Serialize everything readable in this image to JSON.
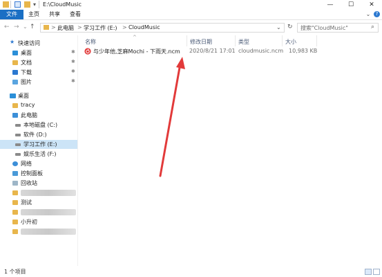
{
  "window": {
    "title": "E:\\CloudMusic",
    "minimize_glyph": "—",
    "maximize_glyph": "☐",
    "close_glyph": "✕"
  },
  "ribbon": {
    "tabs": [
      "文件",
      "主页",
      "共享",
      "查看"
    ],
    "expand_glyph": "⌄",
    "help_glyph": "?"
  },
  "nav": {
    "back_glyph": "←",
    "forward_glyph": "→",
    "recent_glyph": "⌄",
    "up_glyph": "↑"
  },
  "address": {
    "separator": ">",
    "segments": [
      "此电脑",
      "学习工作 (E:)",
      "CloudMusic"
    ],
    "dropdown_glyph": "⌄",
    "refresh_glyph": "↻"
  },
  "search": {
    "placeholder": "搜索\"CloudMusic\"",
    "icon_glyph": "⌕"
  },
  "sidebar": {
    "quick_access": "快速访问",
    "pinned": [
      "桌面",
      "文档",
      "下载",
      "图片"
    ],
    "pin_glyph": "✱",
    "desktop": "桌面",
    "user": "tracy",
    "this_pc": "此电脑",
    "drives": [
      "本地磁盘 (C:)",
      "软件 (D:)",
      "学习工作 (E:)",
      "娱乐生活 (F:)"
    ],
    "network": "网络",
    "control_panel": "控制面板",
    "recycle_bin": "回收站",
    "folders_visible": [
      "测试",
      "小升初"
    ]
  },
  "columns": {
    "name": "名称",
    "modified": "修改日期",
    "type": "类型",
    "size": "大小",
    "sort_glyph": "^"
  },
  "files": [
    {
      "name": "与少年他,芝麻Mochi - 下雨天.ncm",
      "modified": "2020/8/21 17:01",
      "type": "cloudmusic.ncm",
      "size": "10,983 KB"
    }
  ],
  "status": {
    "count": "1 个项目"
  },
  "colors": {
    "accent": "#1a6fc4",
    "selection": "#cce4f7",
    "folder": "#e8b64c",
    "annotation_arrow": "#e23a3a"
  }
}
